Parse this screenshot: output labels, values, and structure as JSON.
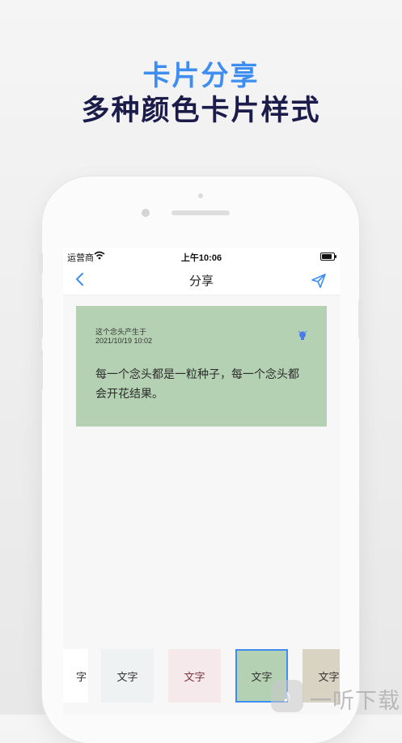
{
  "promo": {
    "title": "卡片分享",
    "subtitle": "多种颜色卡片样式"
  },
  "statusbar": {
    "carrier": "运营商",
    "time": "上午10:06"
  },
  "navbar": {
    "title": "分享",
    "back_icon": "chevron-left-icon",
    "send_icon": "paper-plane-icon"
  },
  "card": {
    "label": "这个念头产生于",
    "date": "2021/10/19 10:02",
    "text": "每一个念头都是一粒种子，每一个念头都会开花结果。",
    "background": "#b5d1b3",
    "icon": "lightbulb-icon"
  },
  "swatches": [
    {
      "label": "字",
      "color": "#ffffff",
      "text_color": "#333333"
    },
    {
      "label": "文字",
      "color": "#eef2f2",
      "text_color": "#333333"
    },
    {
      "label": "文字",
      "color": "#f6e9ec",
      "text_color": "#7a3440"
    },
    {
      "label": "文字",
      "color": "#b5d1b3",
      "text_color": "#333333",
      "selected": true
    },
    {
      "label": "文字",
      "color": "#d9d3c3",
      "text_color": "#333333"
    }
  ],
  "watermark": {
    "text": "一听下载"
  },
  "colors": {
    "accent": "#3d8ef0",
    "headline_dark": "#1b1c4a"
  }
}
